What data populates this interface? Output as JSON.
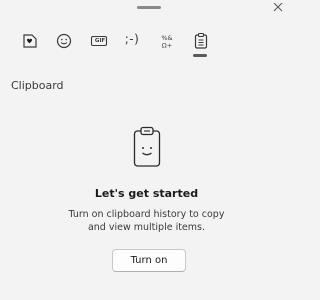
{
  "window": {
    "drag_handle_icon": "drag-handle-icon",
    "close_icon": "close-icon"
  },
  "tabs": [
    {
      "icon": "heart-sticker-icon",
      "label": ""
    },
    {
      "icon": "emoji-icon",
      "label": ""
    },
    {
      "icon": "gif-icon",
      "label": "GIF"
    },
    {
      "icon": "kaomoji-icon",
      "label": ";-)"
    },
    {
      "icon": "symbols-icon",
      "label": "%& Ω+"
    },
    {
      "icon": "clipboard-icon",
      "label": "",
      "selected": true
    }
  ],
  "clipboard": {
    "section_title": "Clipboard",
    "illustration_icon": "smiling-clipboard-icon",
    "heading": "Let's get started",
    "description": "Turn on clipboard history to copy and view multiple items.",
    "button_label": "Turn on"
  },
  "colors": {
    "background": "#f3f3f3",
    "text_primary": "#1b1b1b",
    "text_secondary": "#3a3a3a",
    "tab_indicator": "#5a5a5a"
  }
}
